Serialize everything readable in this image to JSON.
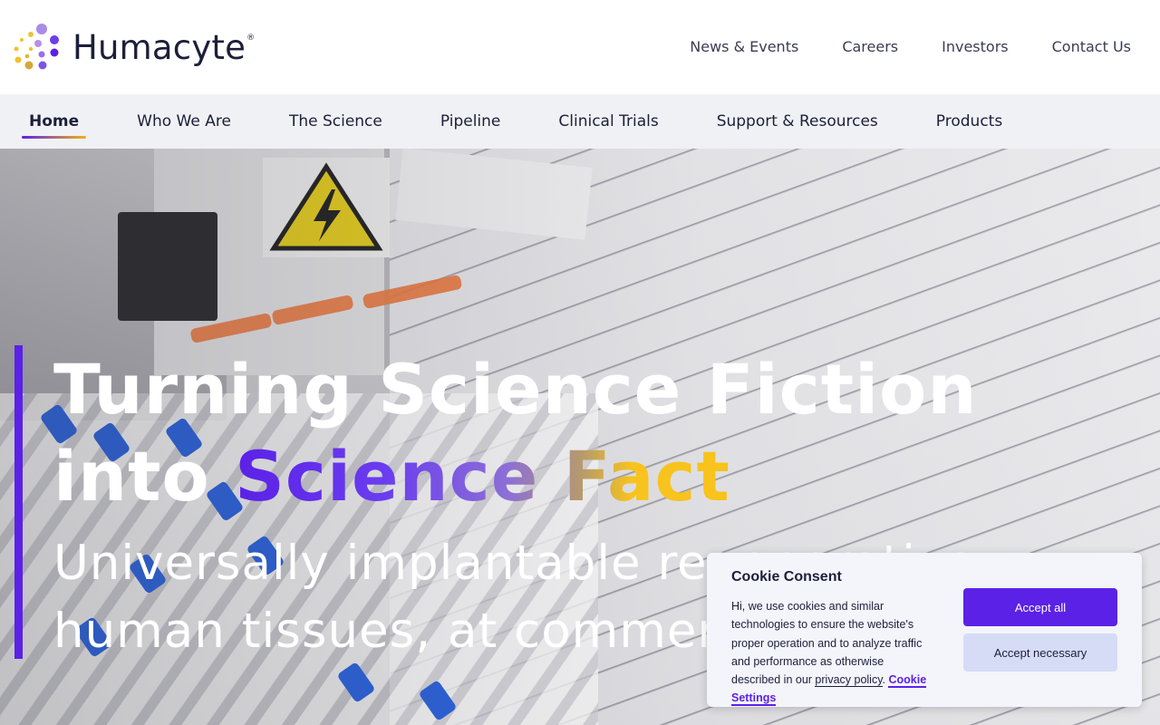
{
  "header": {
    "logo_text": "Humacyte",
    "logo_mark": "®",
    "top_nav": [
      "News & Events",
      "Careers",
      "Investors",
      "Contact Us"
    ]
  },
  "main_nav": {
    "items": [
      {
        "label": "Home",
        "active": true
      },
      {
        "label": "Who We Are"
      },
      {
        "label": "The Science"
      },
      {
        "label": "Pipeline"
      },
      {
        "label": "Clinical Trials"
      },
      {
        "label": "Support & Resources"
      },
      {
        "label": "Products"
      }
    ]
  },
  "hero": {
    "line1_plain": "Turning ",
    "line1_bold": "Science Fiction",
    "line2_plain": "into ",
    "line2_gradient": "Science Fact",
    "subhead": "Universally implantable regenerative human tissues, at commercial scale"
  },
  "cookie": {
    "title": "Cookie Consent",
    "text": "Hi, we use cookies and similar technologies to ensure the website's proper operation and to analyze traffic and performance as otherwise described in our ",
    "privacy_link": "privacy policy",
    "separator": ". ",
    "settings_link": "Cookie Settings",
    "accept_all": "Accept all",
    "accept_necessary": "Accept necessary"
  },
  "colors": {
    "brand_purple": "#5b21e6",
    "brand_yellow": "#f7c31c",
    "text_dark": "#1c1f3a",
    "nav_bg": "#f0f1f4",
    "cookie_bg": "#f4f4fb"
  },
  "icons": {
    "logo": "humacyte-dots-logo-icon"
  }
}
